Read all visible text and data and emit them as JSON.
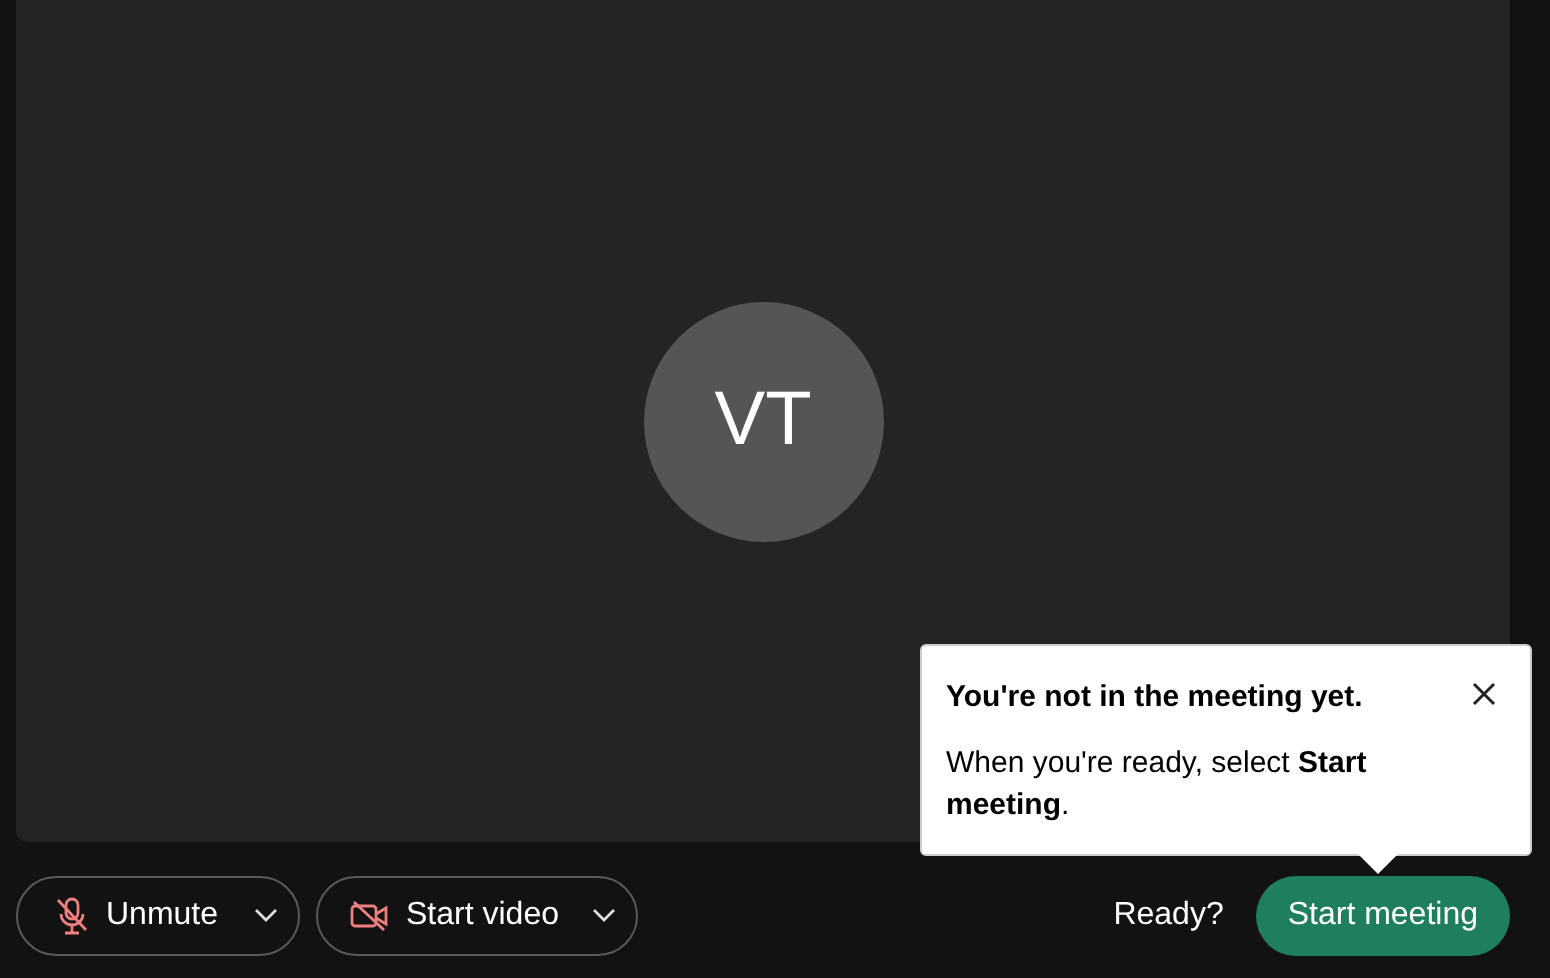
{
  "avatar": {
    "initials": "VT"
  },
  "audio_button": {
    "label": "Unmute",
    "muted": true
  },
  "video_button": {
    "label": "Start video",
    "video_on": false
  },
  "tooltip": {
    "title": "You're not in the meeting yet.",
    "message": "When you're ready, select **Start meeting**."
  },
  "ready_label": "Ready?",
  "start_button": "Start meeting"
}
